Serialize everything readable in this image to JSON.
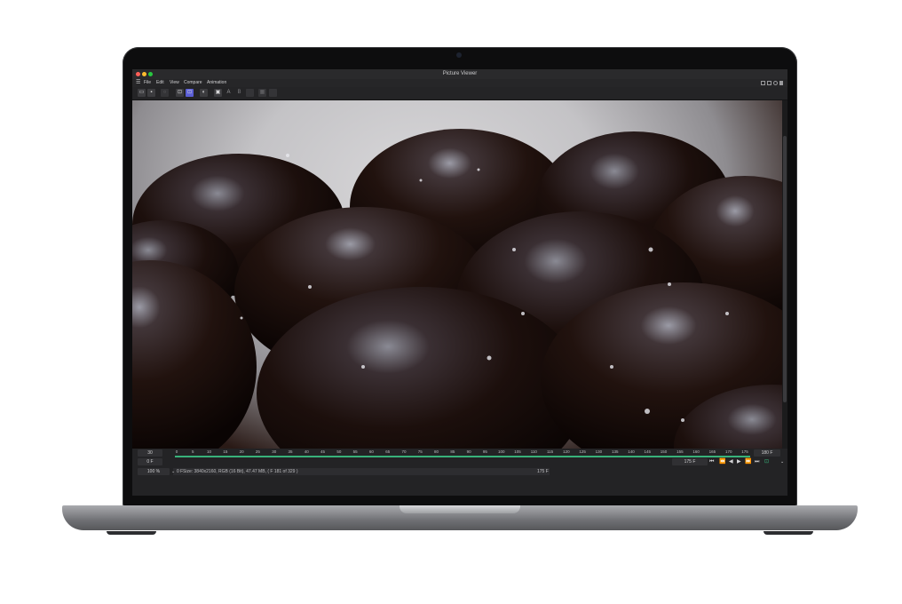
{
  "window": {
    "title": "Picture Viewer",
    "traffic_lights": {
      "close": "#ff5f57",
      "minimize": "#febc2e",
      "zoom": "#28c840"
    }
  },
  "menu": {
    "hamburger": "hamburger-icon",
    "items": [
      "File",
      "Edit",
      "View",
      "Compare",
      "Animation"
    ]
  },
  "toolbar": {
    "icons": [
      "open-folder-icon",
      "save-icon",
      "render-region-icon",
      "single-view-icon",
      "ab-view-icon",
      "contrast-icon",
      "layer-icon",
      "A",
      "B",
      "split-icon",
      "copy-icon",
      "swap-icon"
    ],
    "label_a": "A",
    "label_b": "B"
  },
  "timeline": {
    "current_frame": "30",
    "start": "0 F",
    "range_start": "0 F",
    "range_end_marker": "175 F",
    "end_field": "175 F",
    "max_field": "180 F",
    "zoom": "100 %",
    "ticks": [
      "0",
      "5",
      "10",
      "15",
      "20",
      "25",
      "30",
      "35",
      "40",
      "45",
      "50",
      "55",
      "60",
      "65",
      "70",
      "75",
      "80",
      "85",
      "90",
      "95",
      "100",
      "105",
      "110",
      "115",
      "120",
      "125",
      "130",
      "135",
      "140",
      "145",
      "150",
      "155",
      "160",
      "165",
      "170",
      "175"
    ],
    "transport": {
      "first": "⏮",
      "prev_key": "⏪",
      "prev": "◀",
      "play": "▶",
      "next": "⏩",
      "last": "⏭",
      "record": "⊡"
    },
    "status_text": "Size: 3840x2160, RGB (16 Bit), 47.47 MB, ( F 181 of 329 )",
    "accent": "#38b27a"
  }
}
